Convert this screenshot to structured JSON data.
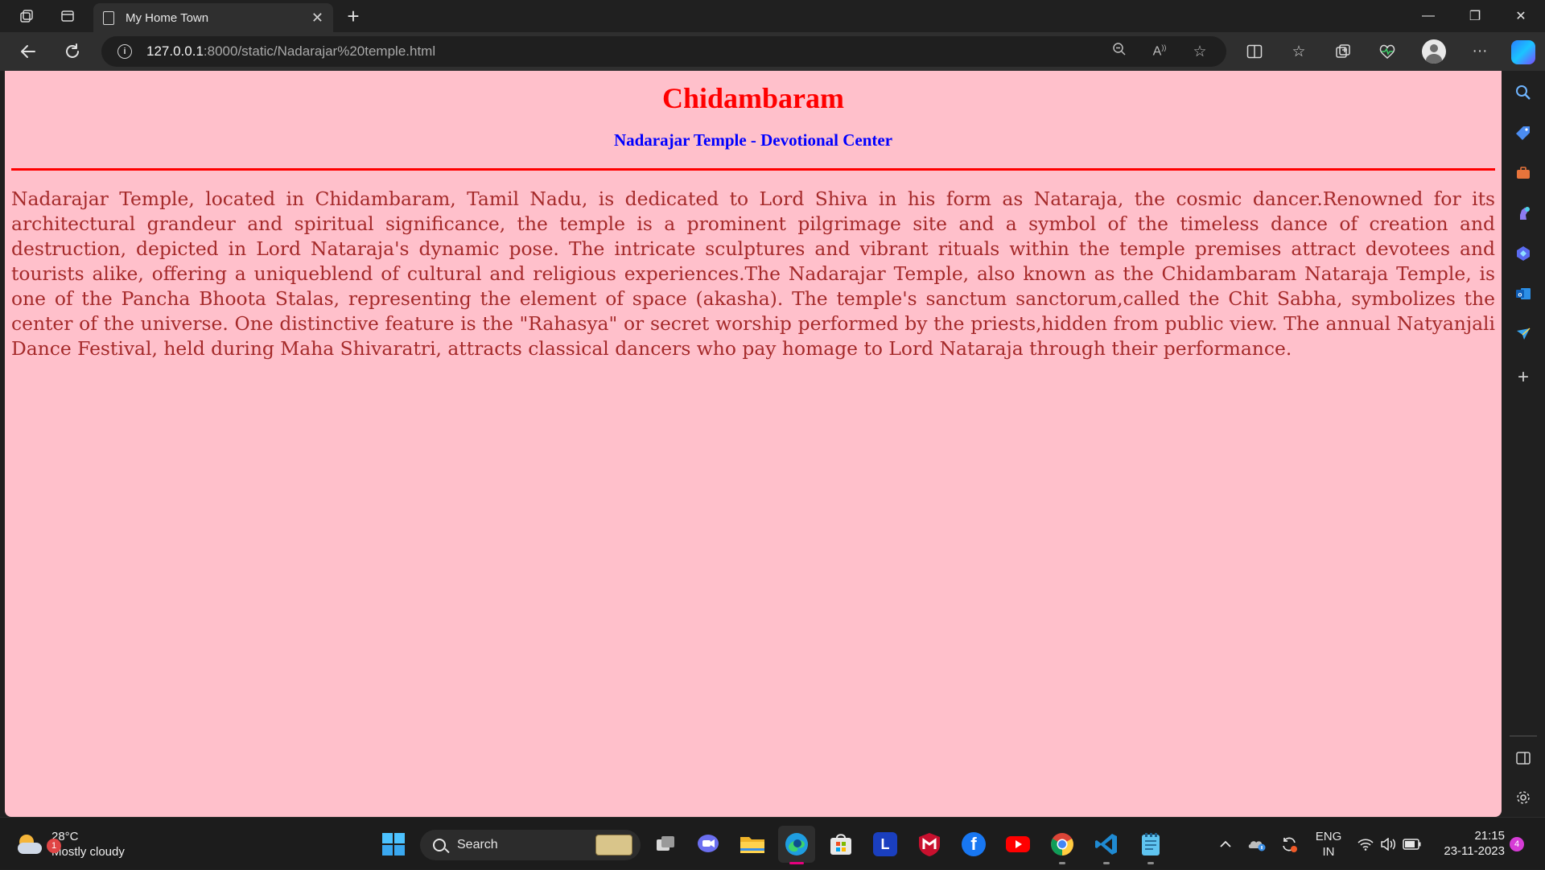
{
  "browser": {
    "tab_title": "My Home Town",
    "tab_close": "✕",
    "new_tab": "+",
    "url_host": "127.0.0.1",
    "url_path": ":8000/static/Nadarajar%20temple.html",
    "window_controls": {
      "minimize": "—",
      "restore": "❐",
      "close": "✕"
    },
    "toolbar_icons": [
      "zoom-out-icon",
      "read-aloud-icon",
      "favorite-star-icon",
      "split-screen-icon",
      "favorites-icon",
      "collections-icon",
      "browser-essentials-icon",
      "profile-avatar",
      "more-icon",
      "copilot-icon"
    ]
  },
  "page": {
    "heading": "Chidambaram",
    "subheading": "Nadarajar Temple - Devotional Center",
    "paragraph": "Nadarajar Temple, located in Chidambaram, Tamil Nadu, is dedicated to Lord Shiva in his form as Nataraja, the cosmic dancer.Renowned for its architectural grandeur and spiritual significance, the temple is a prominent pilgrimage site and a symbol of the timeless dance of creation and destruction, depicted in Lord Nataraja's dynamic pose. The intricate sculptures and vibrant rituals within the temple premises attract devotees and tourists alike, offering a uniqueblend of cultural and religious experiences.The Nadarajar Temple, also known as the Chidambaram Nataraja Temple, is one of the Pancha Bhoota Stalas, representing the element of space (akasha). The temple's sanctum sanctorum,called the Chit Sabha, symbolizes the center of the universe. One distinctive feature is the \"Rahasya\" or secret worship performed by the priests,hidden from public view. The annual Natyanjali Dance Festival, held during Maha Shivaratri, attracts classical dancers who pay homage to Lord Nataraja through their performance.",
    "colors": {
      "background": "#ffc0cb",
      "heading": "#ff0000",
      "subheading": "#0000ff",
      "text": "#a52a2a",
      "rule": "#ff0000"
    }
  },
  "sidebar": {
    "icons": [
      "search-icon",
      "shopping-tag-icon",
      "tools-icon",
      "games-icon",
      "copilot-sidebar-icon",
      "outlook-icon",
      "drop-icon",
      "add-icon",
      "sidebar-toggle-icon",
      "settings-icon"
    ],
    "add": "+"
  },
  "taskbar": {
    "weather_badge": "1",
    "temperature": "28°C",
    "condition": "Mostly cloudy",
    "search_label": "Search",
    "apps": [
      "start-icon",
      "task-view-icon",
      "teams-chat-icon",
      "file-explorer-icon",
      "edge-icon",
      "microsoft-store-icon",
      "l-app-icon",
      "mcafee-icon",
      "facebook-icon",
      "youtube-icon",
      "chrome-icon",
      "vscode-icon",
      "notepad-icon"
    ],
    "l_app_letter": "L",
    "facebook_letter": "f",
    "language_top": "ENG",
    "language_bottom": "IN",
    "time": "21:15",
    "date": "23-11-2023",
    "notification_count": "4"
  }
}
